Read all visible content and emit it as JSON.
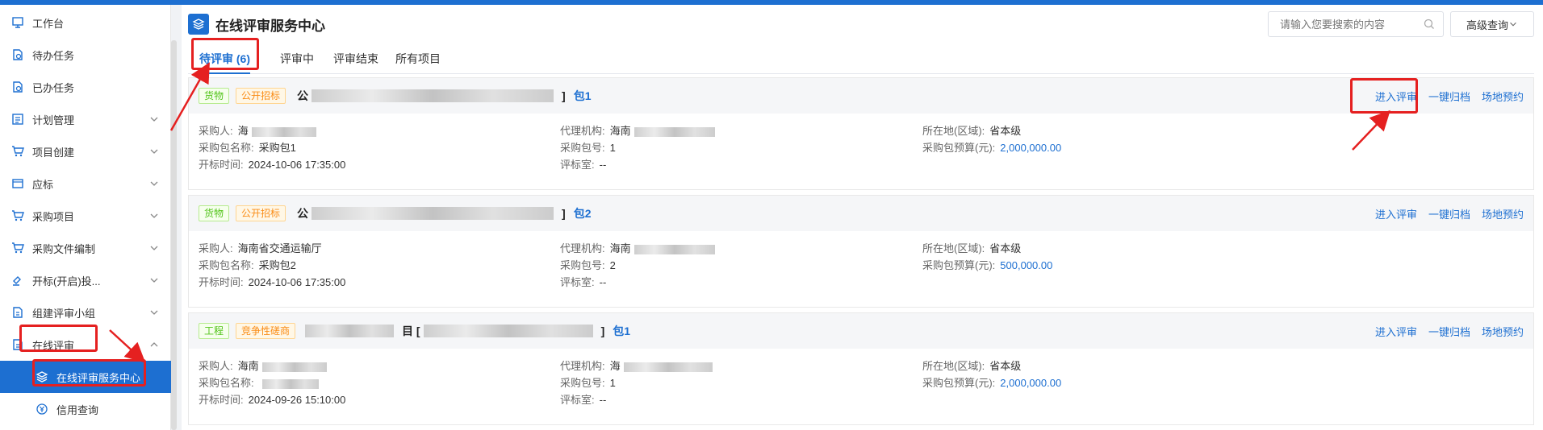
{
  "sidebar": {
    "items": [
      {
        "label": "工作台",
        "icon": "monitor-icon"
      },
      {
        "label": "待办任务",
        "icon": "doc-clock-icon"
      },
      {
        "label": "已办任务",
        "icon": "doc-check-icon"
      },
      {
        "label": "计划管理",
        "icon": "list-icon"
      },
      {
        "label": "项目创建",
        "icon": "cart-icon"
      },
      {
        "label": "应标",
        "icon": "window-icon"
      },
      {
        "label": "采购项目",
        "icon": "cart-icon"
      },
      {
        "label": "采购文件编制",
        "icon": "cart-icon"
      },
      {
        "label": "开标(开启)投...",
        "icon": "gavel-icon"
      },
      {
        "label": "组建评审小组",
        "icon": "doc-icon"
      },
      {
        "label": "在线评审",
        "icon": "doc-icon"
      }
    ],
    "sub_items": [
      {
        "label": "在线评审服务中心",
        "icon": "layers-icon"
      },
      {
        "label": "信用查询",
        "icon": "yen-icon"
      }
    ]
  },
  "header": {
    "title": "在线评审服务中心",
    "search_placeholder": "请输入您要搜索的内容",
    "advanced_label": "高级查询"
  },
  "tabs": [
    "待评审 (6)",
    "评审中",
    "评审结束",
    "所有项目"
  ],
  "labels": {
    "purchaser": "采购人:",
    "agency": "代理机构:",
    "region": "所在地(区域):",
    "package_name": "采购包名称:",
    "package_no": "采购包号:",
    "budget": "采购包预算(元):",
    "open_time": "开标时间:",
    "room": "评标室:"
  },
  "actions": [
    "进入评审",
    "一键归档",
    "场地预约"
  ],
  "cards": [
    {
      "tag1": "货物",
      "tag2": "公开招标",
      "title_prefix": "公",
      "title_suffix": "]",
      "package": "包1",
      "purchaser": "海",
      "agency": "海南",
      "region": "省本级",
      "package_name": "采购包1",
      "package_no": "1",
      "budget": "2,000,000.00",
      "open_time": "2024-10-06 17:35:00",
      "room": "--"
    },
    {
      "tag1": "货物",
      "tag2": "公开招标",
      "title_prefix": "公",
      "title_suffix": "]",
      "package": "包2",
      "purchaser": "海南省交通运输厅",
      "agency": "海南",
      "region": "省本级",
      "package_name": "采购包2",
      "package_no": "2",
      "budget": "500,000.00",
      "open_time": "2024-10-06 17:35:00",
      "room": "--"
    },
    {
      "tag1": "工程",
      "tag2": "竞争性磋商",
      "title_prefix": "",
      "title_suffix": "目 [",
      "package": "包1",
      "purchaser": "海南",
      "agency": "海",
      "region": "省本级",
      "package_name": "",
      "package_no": "1",
      "budget": "2,000,000.00",
      "open_time": "2024-09-26 15:10:00",
      "room": "--"
    }
  ],
  "colors": {
    "accent": "#1d6fd1",
    "highlight": "#e52020",
    "tag_green": "#52c41a",
    "tag_orange": "#fa8c16"
  }
}
